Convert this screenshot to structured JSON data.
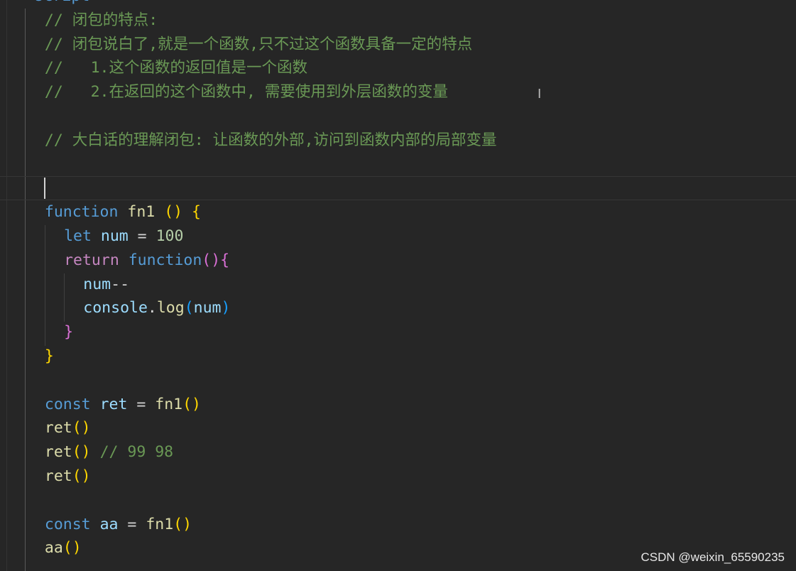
{
  "editor": {
    "lines": [
      {
        "indent": 1,
        "tokens": [
          [
            "<",
            "t-tag"
          ],
          [
            "script",
            "t-tagname"
          ],
          [
            ">",
            "t-tag"
          ]
        ]
      },
      {
        "indent": 2,
        "tokens": [
          [
            "// 闭包的特点:",
            "t-comment"
          ]
        ]
      },
      {
        "indent": 2,
        "tokens": [
          [
            "// 闭包说白了,就是一个函数,只不过这个函数具备一定的特点",
            "t-comment"
          ]
        ]
      },
      {
        "indent": 2,
        "tokens": [
          [
            "//   1.这个函数的返回值是一个函数",
            "t-comment"
          ]
        ]
      },
      {
        "indent": 2,
        "tokens": [
          [
            "//   2.在返回的这个函数中, 需要使用到外层函数的变量",
            "t-comment"
          ]
        ]
      },
      {
        "indent": 2,
        "tokens": []
      },
      {
        "indent": 2,
        "tokens": [
          [
            "// 大白话的理解闭包: 让函数的外部,访问到函数内部的局部变量",
            "t-comment"
          ]
        ]
      },
      {
        "indent": 2,
        "tokens": []
      },
      {
        "indent": 2,
        "tokens": [],
        "current": true
      },
      {
        "indent": 2,
        "tokens": [
          [
            "function",
            "t-kw"
          ],
          [
            " ",
            "t-op"
          ],
          [
            "fn1",
            "t-fn"
          ],
          [
            " ",
            "t-op"
          ],
          [
            "()",
            "t-b1"
          ],
          [
            " ",
            "t-op"
          ],
          [
            "{",
            "t-b1"
          ]
        ]
      },
      {
        "indent": 3,
        "tokens": [
          [
            "let",
            "t-kw"
          ],
          [
            " ",
            "t-op"
          ],
          [
            "num",
            "t-var"
          ],
          [
            " = ",
            "t-op"
          ],
          [
            "100",
            "t-num"
          ]
        ]
      },
      {
        "indent": 3,
        "tokens": [
          [
            "return",
            "t-ctl"
          ],
          [
            " ",
            "t-op"
          ],
          [
            "function",
            "t-kw"
          ],
          [
            "()",
            "t-b2"
          ],
          [
            "{",
            "t-b2"
          ]
        ]
      },
      {
        "indent": 4,
        "tokens": [
          [
            "num",
            "t-var"
          ],
          [
            "--",
            "t-op"
          ]
        ]
      },
      {
        "indent": 4,
        "tokens": [
          [
            "console",
            "t-var"
          ],
          [
            ".",
            "t-op"
          ],
          [
            "log",
            "t-fn"
          ],
          [
            "(",
            "t-b3"
          ],
          [
            "num",
            "t-var"
          ],
          [
            ")",
            "t-b3"
          ]
        ]
      },
      {
        "indent": 3,
        "tokens": [
          [
            "}",
            "t-b2"
          ]
        ]
      },
      {
        "indent": 2,
        "tokens": [
          [
            "}",
            "t-b1"
          ]
        ]
      },
      {
        "indent": 2,
        "tokens": []
      },
      {
        "indent": 2,
        "tokens": [
          [
            "const",
            "t-kw"
          ],
          [
            " ",
            "t-op"
          ],
          [
            "ret",
            "t-var"
          ],
          [
            " = ",
            "t-op"
          ],
          [
            "fn1",
            "t-fn"
          ],
          [
            "()",
            "t-b1"
          ]
        ]
      },
      {
        "indent": 2,
        "tokens": [
          [
            "ret",
            "t-fn"
          ],
          [
            "()",
            "t-b1"
          ]
        ]
      },
      {
        "indent": 2,
        "tokens": [
          [
            "ret",
            "t-fn"
          ],
          [
            "()",
            "t-b1"
          ],
          [
            " ",
            "t-op"
          ],
          [
            "// 99 98",
            "t-comment"
          ]
        ]
      },
      {
        "indent": 2,
        "tokens": [
          [
            "ret",
            "t-fn"
          ],
          [
            "()",
            "t-b1"
          ]
        ]
      },
      {
        "indent": 2,
        "tokens": []
      },
      {
        "indent": 2,
        "tokens": [
          [
            "const",
            "t-kw"
          ],
          [
            " ",
            "t-op"
          ],
          [
            "aa",
            "t-var"
          ],
          [
            " = ",
            "t-op"
          ],
          [
            "fn1",
            "t-fn"
          ],
          [
            "()",
            "t-b1"
          ]
        ]
      },
      {
        "indent": 2,
        "tokens": [
          [
            "aa",
            "t-fn"
          ],
          [
            "()",
            "t-b1"
          ]
        ]
      }
    ]
  },
  "watermark": "CSDN @weixin_65590235"
}
